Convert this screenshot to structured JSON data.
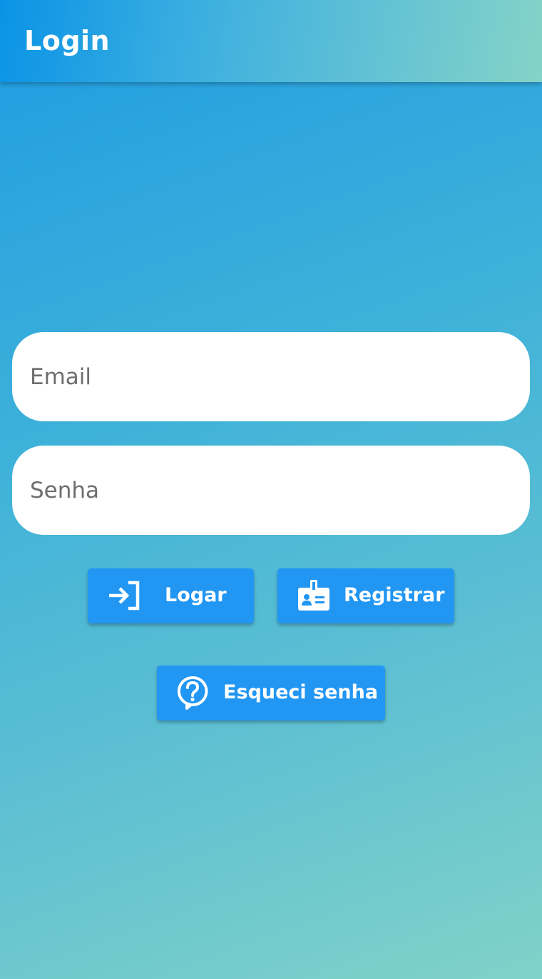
{
  "app_bar": {
    "title": "Login"
  },
  "form": {
    "email": {
      "placeholder": "Email",
      "value": ""
    },
    "password": {
      "placeholder": "Senha",
      "value": ""
    }
  },
  "buttons": {
    "login": {
      "label": "Logar",
      "icon": "login-icon"
    },
    "register": {
      "label": "Registrar",
      "icon": "badge-icon"
    },
    "forgot": {
      "label": "Esqueci senha",
      "icon": "help-bubble-icon"
    }
  },
  "colors": {
    "button_bg": "#2196f3",
    "text_on_button": "#ffffff",
    "gradient_start": "#0a93e6",
    "gradient_end": "#85d3c7"
  }
}
